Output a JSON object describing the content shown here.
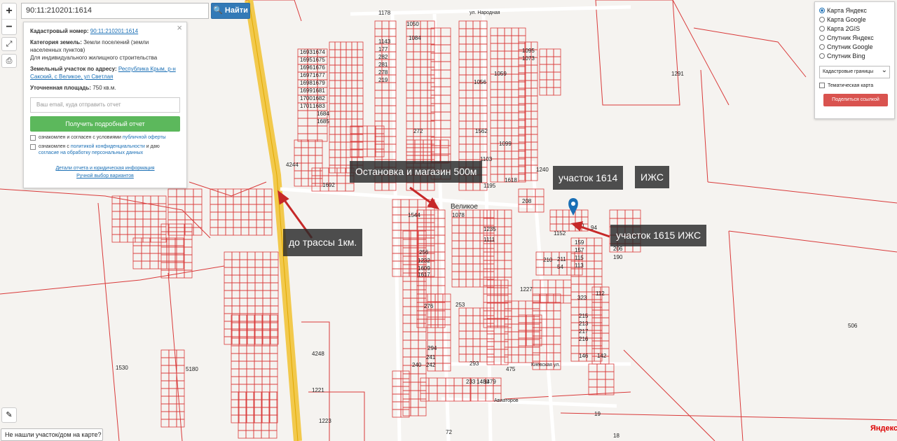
{
  "search": {
    "value": "90:11:210201:1614",
    "button": "Найти"
  },
  "zoom": {
    "plus": "+",
    "minus": "−"
  },
  "tools": {
    "fullscreen_icon": "expand-icon",
    "print_icon": "print-icon",
    "ruler_icon": "ruler-icon"
  },
  "info": {
    "cadastral_label": "Кадастровый номер:",
    "cadastral_value": "90:11:210201:1614",
    "category_label": "Категория земель:",
    "category_value": "Земли поселений (земли населенных пунктов)",
    "purpose": "Для индивидуального жилищного строительства",
    "address_label": "Земельный участок по адресу:",
    "address_value": "Республика Крым, р-н Сакский, с Великое, ул Светлая",
    "area_label": "Уточненная площадь:",
    "area_value": "750 кв.м.",
    "email_placeholder": "Ваш email, куда отправить отчет",
    "get_report": "Получить подробный отчет",
    "agree1_pre": "ознакомлен и согласен с условиями ",
    "agree1_link": "публичной оферты",
    "agree2_pre": "ознакомлен с ",
    "agree2_link": "политикой конфиденциальности",
    "agree2_post": " и даю",
    "agree2_link2": "согласие на обработку персональных данных",
    "details_link": "Детали отчета и юридическая информация",
    "manual_link": "Ручной выбор вариантов"
  },
  "layers": {
    "options": [
      "Карта Яндекс",
      "Карта Google",
      "Карта 2GIS",
      "Спутник Яндекс",
      "Спутник Google",
      "Спутник Bing"
    ],
    "selected": 0,
    "dropdown": "Кадастровые границы",
    "thematic": "Тематическая карта",
    "share": "Поделиться ссылкой"
  },
  "annotations": {
    "stop": "Остановка и магазин 500м",
    "plot1614": "участок 1614",
    "izhs": "ИЖС",
    "plot1615": "участок 1615 ИЖС",
    "highway": "до трассы 1км."
  },
  "village_name": "Великое",
  "street_labels": [
    "ул. Народная",
    "Киевская ул.",
    "Авиаторов"
  ],
  "parcel_numbers": [
    "1693",
    "1674",
    "1695",
    "1675",
    "1696",
    "1676",
    "1697",
    "1677",
    "1698",
    "1679",
    "1699",
    "1681",
    "1700",
    "1682",
    "1701",
    "1683",
    "1684",
    "1685",
    "1692",
    "1178",
    "1050",
    "1084",
    "1143",
    "177",
    "282",
    "281",
    "278",
    "219",
    "272",
    "1095",
    "1073",
    "1059",
    "1056",
    "1562",
    "1099",
    "1240",
    "1195",
    "1103",
    "1078",
    "1235",
    "1111",
    "1544",
    "1152",
    "159",
    "157",
    "115",
    "113",
    "112",
    "323",
    "215",
    "213",
    "217",
    "216",
    "146",
    "142",
    "253",
    "276",
    "256",
    "294",
    "293",
    "241",
    "242",
    "240",
    "4244",
    "4248",
    "1530",
    "5180",
    "1221",
    "1223",
    "1291",
    "5404",
    "506",
    "72",
    "19",
    "18",
    "475",
    "1227",
    "1232",
    "1609",
    "1617",
    "1618",
    "230",
    "206",
    "190",
    "54",
    "211",
    "210",
    "94",
    "208",
    "233",
    "1480",
    "1479",
    "1476"
  ],
  "attribution": "Яндекс",
  "not_found": "Не нашли участок/дом на карте?"
}
